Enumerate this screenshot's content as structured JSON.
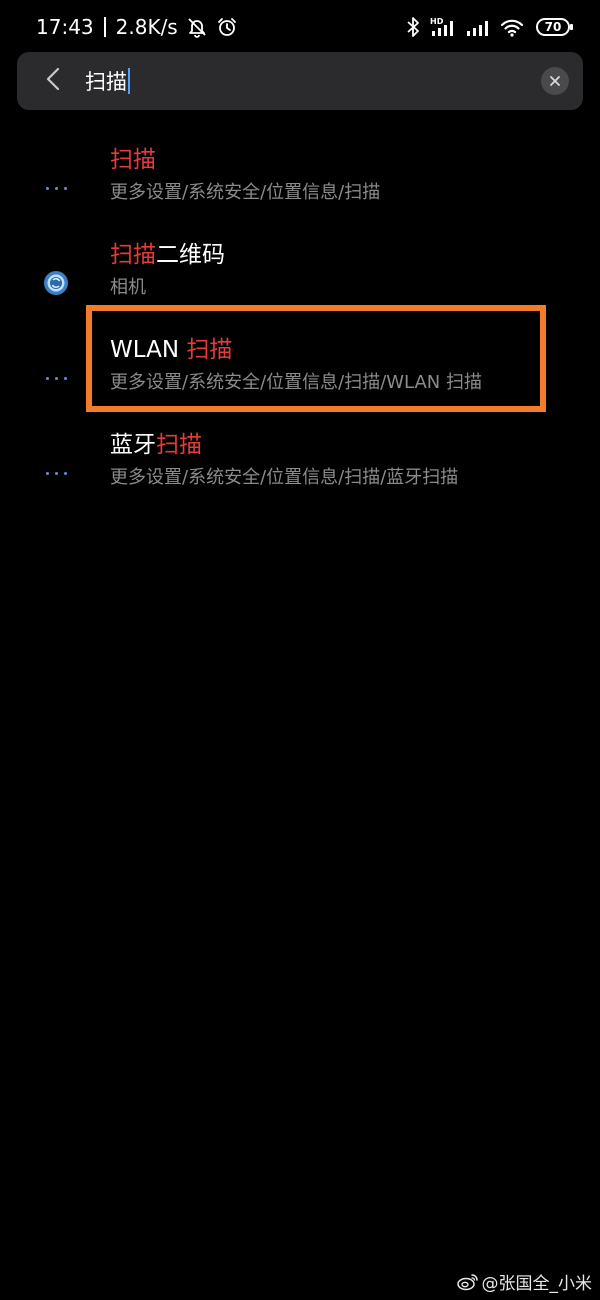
{
  "status_bar": {
    "time": "17:43",
    "net_speed": "2.8K/s",
    "battery": "70",
    "icons": [
      "bell-off-icon",
      "alarm-icon",
      "bluetooth-icon",
      "hd-signal-icon",
      "signal-icon",
      "wifi-icon",
      "battery-icon"
    ]
  },
  "search": {
    "query": "扫描",
    "icons": [
      "back-arrow-icon",
      "clear-icon"
    ]
  },
  "results": [
    {
      "icon": "more-dots-icon",
      "title_highlight": "扫描",
      "title_pre": "",
      "title_post": "",
      "path": "更多设置/系统安全/位置信息/扫描"
    },
    {
      "icon": "camera-icon",
      "title_highlight": "扫描",
      "title_pre": "",
      "title_post": "二维码",
      "path": "相机"
    },
    {
      "icon": "more-dots-icon",
      "title_highlight": "扫描",
      "title_pre": "WLAN ",
      "title_post": "",
      "path": "更多设置/系统安全/位置信息/扫描/WLAN 扫描"
    },
    {
      "icon": "more-dots-icon",
      "title_highlight": "扫描",
      "title_pre": "蓝牙",
      "title_post": "",
      "path": "更多设置/系统安全/位置信息/扫描/蓝牙扫描"
    }
  ],
  "watermark": {
    "text": "@张国全_小米",
    "icon": "weibo-icon"
  },
  "colors": {
    "background": "#000000",
    "search_bg": "#2b2b2d",
    "highlight_text": "#e53b3b",
    "path_text": "#8b8b8b",
    "frame": "#f47b2a",
    "dots": "#5d8fd6",
    "caret": "#4ea3ff"
  }
}
